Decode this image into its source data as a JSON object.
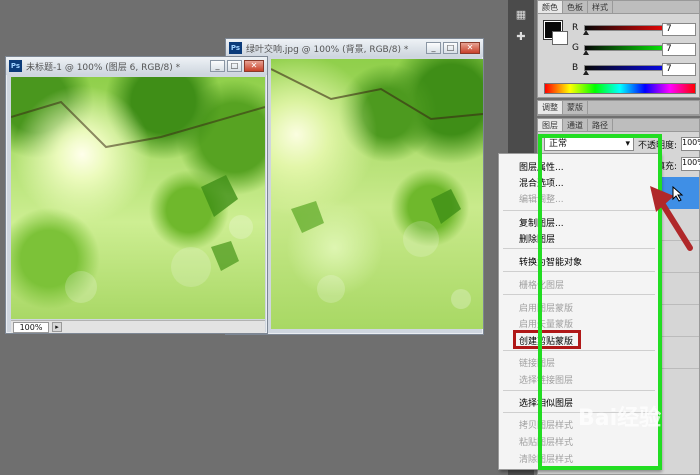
{
  "doc1": {
    "title": "未标题-1 @ 100% (图层 6, RGB/8) *",
    "zoom": "100%"
  },
  "doc2": {
    "title": "绿叶交响.jpg @ 100% (背景, RGB/8) *"
  },
  "window_buttons": {
    "minimize": "_",
    "maximize": "□",
    "close": "✕"
  },
  "ps_badge": "Ps",
  "color_panel": {
    "tabs": [
      "颜色",
      "色板",
      "样式"
    ],
    "channels": [
      {
        "label": "R",
        "value": "7"
      },
      {
        "label": "G",
        "value": "7"
      },
      {
        "label": "B",
        "value": "7"
      }
    ]
  },
  "adjust_tabs": [
    "调整",
    "蒙版"
  ],
  "layers_panel": {
    "tabs": [
      "图层",
      "通道",
      "路径"
    ],
    "blend_mode": "正常",
    "opacity_label": "不透明度:",
    "opacity_value": "100%",
    "fill_label": "填充:",
    "fill_value": "100%"
  },
  "context_menu": {
    "items": [
      {
        "label": "图层属性...",
        "enabled": true
      },
      {
        "label": "混合选项...",
        "enabled": true
      },
      {
        "label": "编辑调整...",
        "enabled": false
      },
      {
        "label": "复制图层...",
        "enabled": true
      },
      {
        "label": "删除图层",
        "enabled": true
      },
      {
        "label": "转换为智能对象",
        "enabled": true
      },
      {
        "label": "栅格化图层",
        "enabled": false
      },
      {
        "label": "启用图层蒙版",
        "enabled": false
      },
      {
        "label": "启用矢量蒙版",
        "enabled": false
      },
      {
        "label": "创建剪贴蒙版",
        "enabled": true
      },
      {
        "label": "链接图层",
        "enabled": false
      },
      {
        "label": "选择链接图层",
        "enabled": false
      },
      {
        "label": "选择相似图层",
        "enabled": true
      },
      {
        "label": "拷贝图层样式",
        "enabled": false
      },
      {
        "label": "粘贴图层样式",
        "enabled": false
      },
      {
        "label": "清除图层样式",
        "enabled": false
      }
    ]
  },
  "watermark": "Bai经验",
  "colors": {
    "highlight_green": "#22dd22",
    "highlight_red": "#b01818",
    "arrow_red": "#b0282a"
  }
}
